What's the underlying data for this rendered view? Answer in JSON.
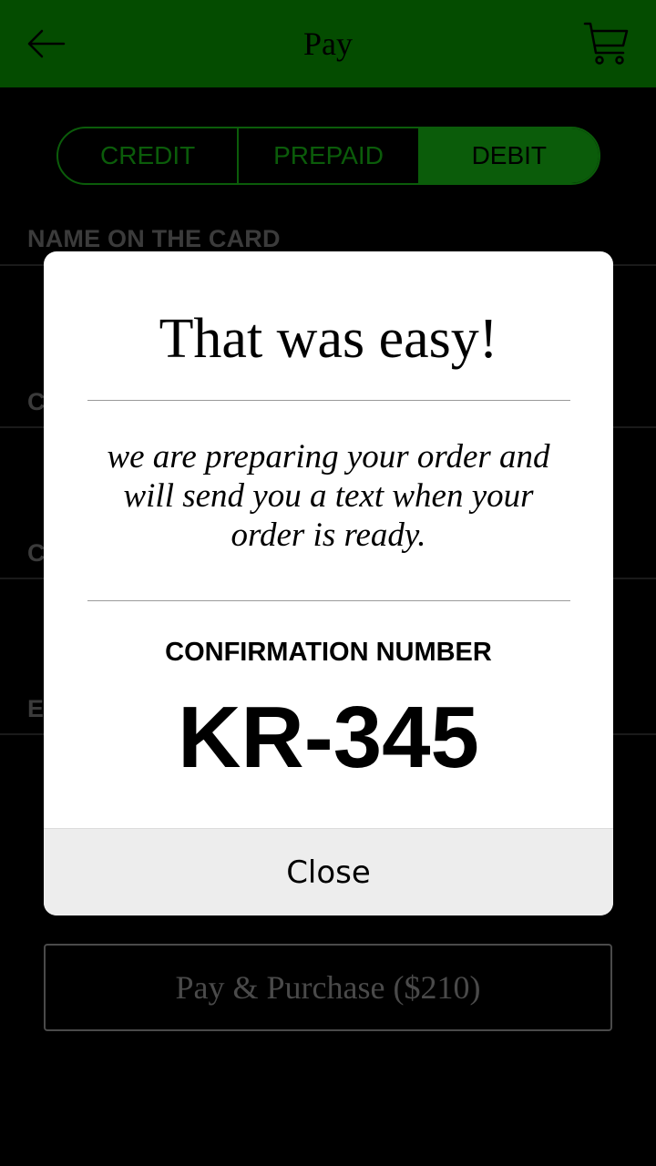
{
  "header": {
    "title": "Pay",
    "back_icon": "arrow-left-icon",
    "cart_icon": "shopping-cart-icon"
  },
  "payment_tabs": {
    "items": [
      {
        "label": "CREDIT",
        "active": false
      },
      {
        "label": "PREPAID",
        "active": false
      },
      {
        "label": "DEBIT",
        "active": true
      }
    ]
  },
  "form": {
    "name_label": "NAME ON THE CARD",
    "field2_label_visible": "C",
    "field3_label_visible": "C",
    "field4_label_visible": "E"
  },
  "pay_button": {
    "label": "Pay & Purchase ($210)"
  },
  "modal": {
    "title": "That was easy!",
    "message": "we are preparing your order and will send you a text when your order is ready.",
    "confirmation_label": "CONFIRMATION NUMBER",
    "confirmation_number": "KR-345",
    "close_label": "Close"
  },
  "colors": {
    "header_bg": "#044c00",
    "accent_green": "#0b5c0a",
    "background": "#000000",
    "modal_bg": "#ffffff",
    "close_bg": "#ededed"
  }
}
